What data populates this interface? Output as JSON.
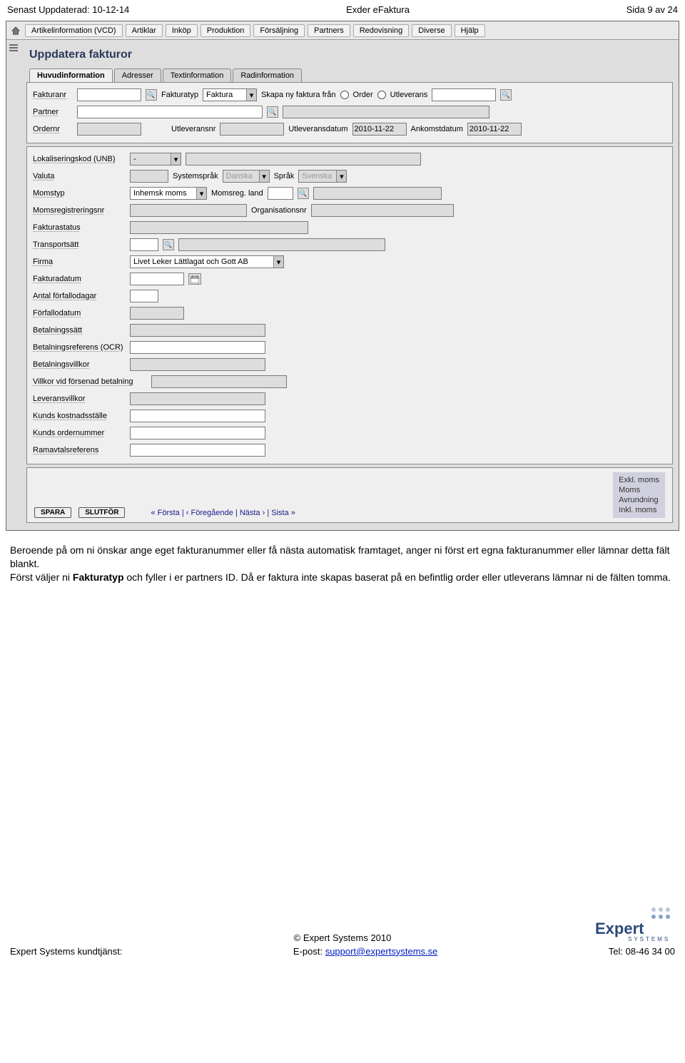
{
  "header": {
    "left": "Senast Uppdaterad: 10-12-14",
    "center": "Exder eFaktura",
    "right": "Sida 9 av 24"
  },
  "menubar": {
    "items": [
      "Artikelinformation (VCD)",
      "Artiklar",
      "Inköp",
      "Produktion",
      "Försäljning",
      "Partners",
      "Redovisning",
      "Diverse",
      "Hjälp"
    ]
  },
  "pageTitle": "Uppdatera fakturor",
  "tabs": [
    "Huvudinformation",
    "Adresser",
    "Textinformation",
    "Radinformation"
  ],
  "panel1": {
    "fakturanr": "Fakturanr",
    "fakturatyp": "Fakturatyp",
    "fakturatyp_val": "Faktura",
    "skapa": "Skapa ny faktura från",
    "order": "Order",
    "utleverans": "Utleverans",
    "partner": "Partner",
    "ordernr": "Ordernr",
    "utleveransnr": "Utleveransnr",
    "utleveransdatum": "Utleveransdatum",
    "utlev_date_val": "2010-11-22",
    "ankomst": "Ankomstdatum",
    "ankomst_val": "2010-11-22"
  },
  "panel2": {
    "lokal": "Lokaliseringskod (UNB)",
    "dash": "-",
    "valuta": "Valuta",
    "systemspr_l": "Systemspråk",
    "systemspr_v": "Danska",
    "sprak_l": "Språk",
    "sprak_v": "Svenska",
    "momstyp": "Momstyp",
    "momstyp_v": "Inhemsk moms",
    "momsreg_land": "Momsreg. land",
    "momsregnr": "Momsregistreringsnr",
    "orgnr": "Organisationsnr",
    "fakturastatus": "Fakturastatus",
    "transportsatt": "Transportsätt",
    "firma": "Firma",
    "firma_v": "Livet Leker Lättlagat och Gott AB",
    "fakturadatum": "Fakturadatum",
    "antal_fd": "Antal förfallodagar",
    "forfallodatum": "Förfallodatum",
    "betalningssatt": "Betalningssätt",
    "ocr": "Betalningsreferens (OCR)",
    "betalningsvillkor": "Betalningsvillkor",
    "villkor_forsenad": "Villkor vid försenad betalning",
    "leveransvillkor": "Leveransvillkor",
    "kunds_kost": "Kunds kostnadsställe",
    "kunds_ord": "Kunds ordernummer",
    "ramavtal": "Ramavtalsreferens"
  },
  "bottom": {
    "spara": "SPARA",
    "slutfor": "SLUTFÖR",
    "pager": "« Första | ‹ Föregående | Nästa › | Sista »",
    "totals": [
      "Exkl. moms",
      "Moms",
      "Avrundning",
      "Inkl. moms"
    ]
  },
  "bodyText": {
    "p1a": "Beroende på om ni önskar ange eget fakturanummer eller få nästa automatisk framtaget, anger ni först ert egna fakturanummer eller lämnar detta fält blankt.",
    "p2a": "Först väljer ni ",
    "p2b": "Fakturatyp",
    "p2c": " och fyller i er partners ID. Då er faktura inte skapas baserat på en befintlig order eller utleverans lämnar ni de fälten tomma."
  },
  "footer": {
    "copyright": "© Expert Systems 2010",
    "left": "Expert Systems kundtjänst:",
    "midLabel": "E-post: ",
    "midLink": "support@expertsystems.se",
    "right": "Tel: 08-46 34 00"
  }
}
